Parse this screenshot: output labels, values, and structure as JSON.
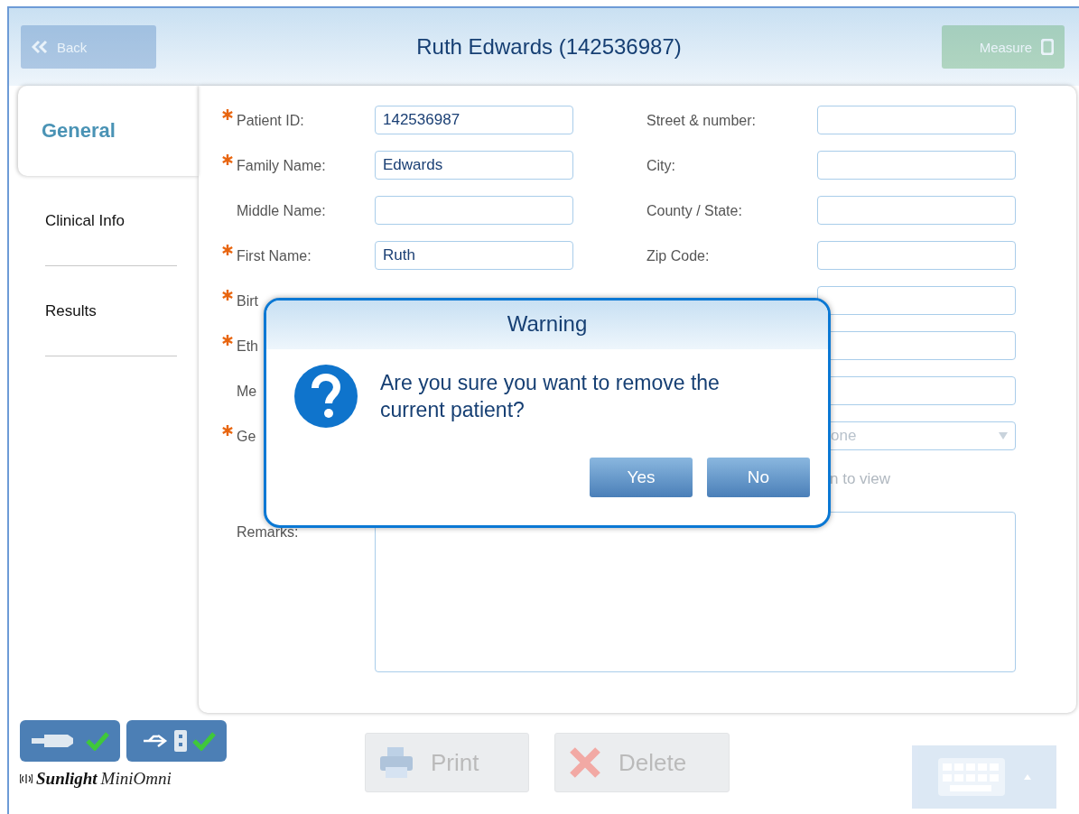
{
  "header": {
    "title": "Ruth Edwards (142536987)",
    "back_button": {
      "label": "Back",
      "disabled": true
    },
    "measure_button": {
      "label": "Measure",
      "disabled": true
    }
  },
  "tabs": [
    {
      "label": "General",
      "selected": true
    },
    {
      "label": "Clinical Info",
      "selected": false
    },
    {
      "label": "Results",
      "selected": false
    }
  ],
  "form": {
    "left_rows": [
      {
        "kind": "field",
        "label": "Patient ID:",
        "required": true,
        "value": "142536987"
      },
      {
        "kind": "field",
        "label": "Family Name:",
        "required": true,
        "value": "Edwards"
      },
      {
        "kind": "field",
        "label": "Middle Name:",
        "required": false
      },
      {
        "kind": "field",
        "label": "First Name:",
        "required": true,
        "value": "Ruth"
      },
      {
        "kind": "label_only",
        "label": "Birt",
        "required": true
      },
      {
        "kind": "label_only",
        "label": "Eth",
        "required": true
      },
      {
        "kind": "label_only",
        "label": "Me",
        "required": false
      },
      {
        "kind": "label_only",
        "label": "Ge",
        "required": true
      }
    ],
    "right_rows": [
      {
        "kind": "field",
        "label": "Street & number:"
      },
      {
        "kind": "field",
        "label": "City:"
      },
      {
        "kind": "field",
        "label": "County / State:"
      },
      {
        "kind": "field",
        "label": "Zip Code:"
      },
      {
        "kind": "field"
      },
      {
        "kind": "field"
      },
      {
        "kind": "field"
      },
      {
        "kind": "dropdown",
        "value": "one"
      }
    ],
    "note": "n to view",
    "remarks": {
      "label": "Remarks:"
    }
  },
  "dialog": {
    "title": "Warning",
    "message": "Are you sure you want to remove the current patient?",
    "buttons": [
      "Yes",
      "No"
    ]
  },
  "footer": {
    "devices": [
      {
        "kind": "probe",
        "connected": true
      },
      {
        "kind": "usb",
        "connected": true
      }
    ],
    "brand": "Sunlight",
    "product": "MiniOmni",
    "print_button": {
      "label": "Print",
      "disabled": true
    },
    "delete_button": {
      "label": "Delete",
      "disabled": true
    },
    "keyboard_button": {
      "disabled": true
    }
  }
}
